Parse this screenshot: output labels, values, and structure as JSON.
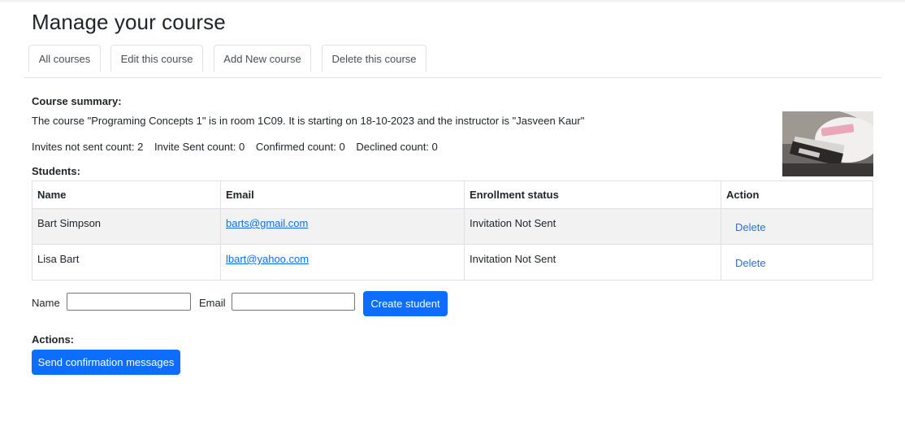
{
  "page": {
    "title": "Manage your course"
  },
  "tabs": [
    {
      "label": "All courses"
    },
    {
      "label": "Edit this course"
    },
    {
      "label": "Add New course"
    },
    {
      "label": "Delete this course"
    }
  ],
  "summary": {
    "heading": "Course summary:",
    "text": "The course \"Programing Concepts 1\" is in room 1C09. It is starting on 18-10-2023 and the instructor is \"Jasveen Kaur\"",
    "counts": {
      "not_sent": "Invites not sent count: 2",
      "sent": "Invite Sent count: 0",
      "confirmed": "Confirmed count: 0",
      "declined": "Declined count: 0"
    },
    "image": {
      "icon": "course-photo-books-on-chair"
    }
  },
  "students": {
    "heading": "Students:",
    "columns": [
      "Name",
      "Email",
      "Enrollment status",
      "Action"
    ],
    "rows": [
      {
        "name": "Bart Simpson",
        "email": "barts@gmail.com",
        "status": "Invitation Not Sent",
        "action": "Delete"
      },
      {
        "name": "Lisa Bart",
        "email": "lbart@yahoo.com",
        "status": "Invitation Not Sent",
        "action": "Delete"
      }
    ]
  },
  "form": {
    "name_label": "Name",
    "name_value": "",
    "email_label": "Email",
    "email_value": "",
    "submit_label": "Create student"
  },
  "actions": {
    "heading": "Actions:",
    "send_label": "Send confirmation messages"
  },
  "colors": {
    "primary": "#0d6efd",
    "border": "#dee2e6",
    "stripe": "#f2f2f2"
  }
}
